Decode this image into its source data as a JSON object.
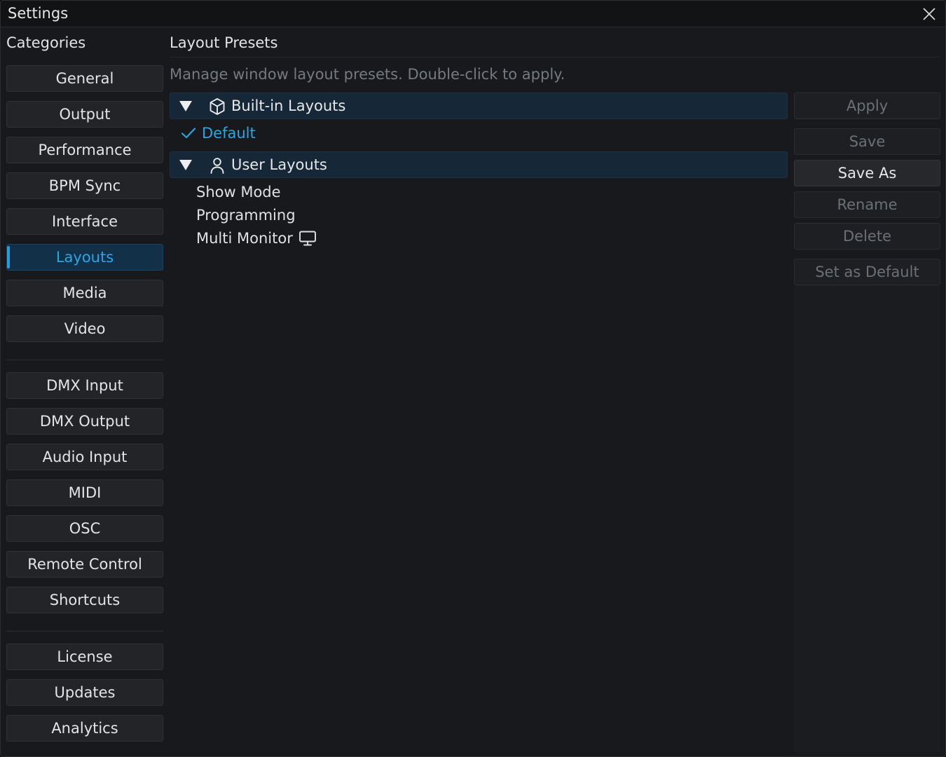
{
  "window": {
    "title": "Settings"
  },
  "sidebar": {
    "header": "Categories",
    "groups": [
      [
        "General",
        "Output",
        "Performance",
        "BPM Sync",
        "Interface",
        "Layouts",
        "Media",
        "Video"
      ],
      [
        "DMX Input",
        "DMX Output",
        "Audio Input",
        "MIDI",
        "OSC",
        "Remote Control",
        "Shortcuts"
      ],
      [
        "License",
        "Updates",
        "Analytics"
      ]
    ],
    "active": "Layouts"
  },
  "panel": {
    "title": "Layout Presets",
    "description": "Manage window layout presets. Double-click to apply.",
    "builtin": {
      "label": "Built-in Layouts",
      "icon": "cube-icon",
      "items": [
        {
          "label": "Default",
          "selected": true,
          "icon": "check-icon"
        }
      ]
    },
    "user": {
      "label": "User Layouts",
      "icon": "user-icon",
      "items": [
        {
          "label": "Show Mode"
        },
        {
          "label": "Programming"
        },
        {
          "label": "Multi Monitor",
          "icon": "monitor-icon"
        }
      ]
    }
  },
  "actions": {
    "apply": "Apply",
    "save": "Save",
    "save_as": "Save As",
    "rename": "Rename",
    "delete": "Delete",
    "set_default": "Set as Default"
  },
  "colors": {
    "accent": "#2aa6e6",
    "background": "#18191c",
    "button": "#232428",
    "group_header": "#162737"
  }
}
